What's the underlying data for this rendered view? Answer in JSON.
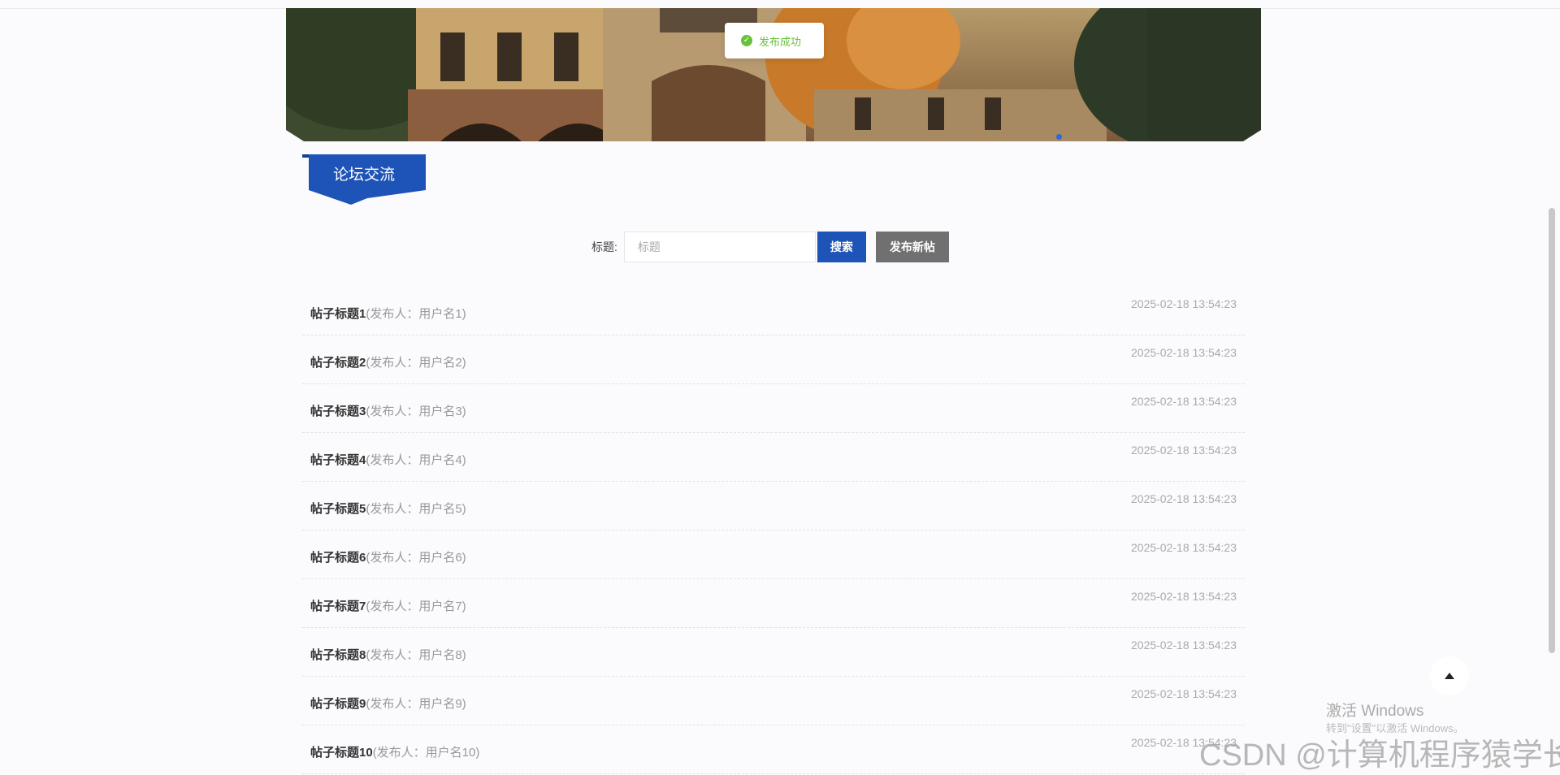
{
  "toast": {
    "text": "发布成功"
  },
  "section": {
    "title": "论坛交流"
  },
  "search": {
    "label": "标题:",
    "placeholder": "标题",
    "search_button": "搜索",
    "new_post_button": "发布新帖"
  },
  "posts": [
    {
      "title": "帖子标题1",
      "author": "(发布人：用户名1)",
      "time": "2025-02-18 13:54:23"
    },
    {
      "title": "帖子标题2",
      "author": "(发布人：用户名2)",
      "time": "2025-02-18 13:54:23"
    },
    {
      "title": "帖子标题3",
      "author": "(发布人：用户名3)",
      "time": "2025-02-18 13:54:23"
    },
    {
      "title": "帖子标题4",
      "author": "(发布人：用户名4)",
      "time": "2025-02-18 13:54:23"
    },
    {
      "title": "帖子标题5",
      "author": "(发布人：用户名5)",
      "time": "2025-02-18 13:54:23"
    },
    {
      "title": "帖子标题6",
      "author": "(发布人：用户名6)",
      "time": "2025-02-18 13:54:23"
    },
    {
      "title": "帖子标题7",
      "author": "(发布人：用户名7)",
      "time": "2025-02-18 13:54:23"
    },
    {
      "title": "帖子标题8",
      "author": "(发布人：用户名8)",
      "time": "2025-02-18 13:54:23"
    },
    {
      "title": "帖子标题9",
      "author": "(发布人：用户名9)",
      "time": "2025-02-18 13:54:23"
    },
    {
      "title": "帖子标题10",
      "author": "(发布人：用户名10)",
      "time": "2025-02-18 13:54:23"
    }
  ],
  "watermark": {
    "windows_line1": "激活 Windows",
    "windows_line2": "转到\"设置\"以激活 Windows。",
    "csdn": "CSDN @计算机程序猿学长"
  },
  "colors": {
    "primary": "#1e53b8",
    "success": "#67c23a",
    "secondary_button": "#707070"
  }
}
